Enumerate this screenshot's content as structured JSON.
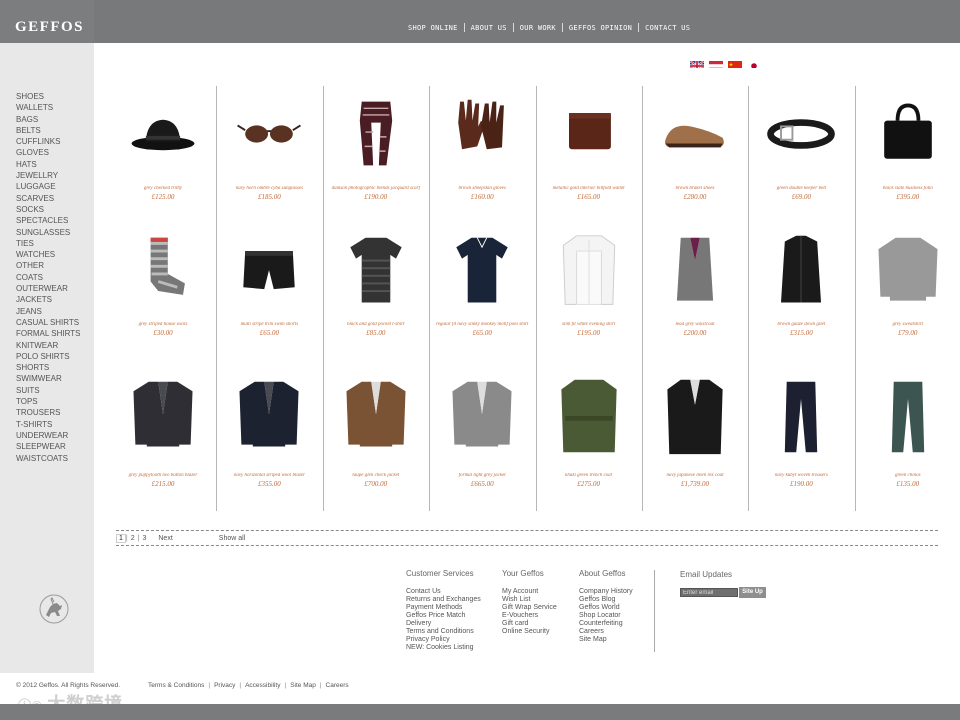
{
  "brand": {
    "logo": "GEFFOS"
  },
  "nav": {
    "items": [
      "SHOP ONLINE",
      "ABOUT US",
      "OUR WORK",
      "GEFFOS OPINION",
      "CONTACT US"
    ]
  },
  "categories": [
    "SHOES",
    "WALLETS",
    "BAGS",
    "BELTS",
    "CUFFLINKS",
    "GLOVES",
    "HATS",
    "JEWELLRY",
    "LUGGAGE",
    "SCARVES",
    "SOCKS",
    "SPECTACLES",
    "SUNGLASSES",
    "TIES",
    "WATCHES",
    "OTHER",
    "COATS",
    "OUTERWEAR",
    "JACKETS",
    "JEANS",
    "CASUAL SHIRTS",
    "FORMAL SHIRTS",
    "KNITWEAR",
    "POLO SHIRTS",
    "SHORTS",
    "SWIMWEAR",
    "SUITS",
    "TOPS",
    "TROUSERS",
    "T-SHIRTS",
    "UNDERWEAR",
    "SLEEPWEAR",
    "WAISTCOATS"
  ],
  "flags": [
    "uk-flag-icon",
    "hungary-flag-icon",
    "china-flag-icon",
    "japan-flag-icon"
  ],
  "products": [
    {
      "name": "grey checked trilby",
      "price": "£125.00",
      "icon": "hat-icon"
    },
    {
      "name": "navy horn ombre cyba sunglasses",
      "price": "£185.00",
      "icon": "sunglasses-icon"
    },
    {
      "name": "damson photographic blends jacquard scarf",
      "price": "£190.00",
      "icon": "scarf-icon"
    },
    {
      "name": "brown sheepskin gloves",
      "price": "£160.00",
      "icon": "gloves-icon"
    },
    {
      "name": "metallic gold interior billfold wallet",
      "price": "£165.00",
      "icon": "wallet-icon"
    },
    {
      "name": "brown brakel shoes",
      "price": "£280.00",
      "icon": "shoe-icon"
    },
    {
      "name": "green double keeper belt",
      "price": "£69.00",
      "icon": "belt-icon"
    },
    {
      "name": "black slate business folio",
      "price": "£395.00",
      "icon": "bag-icon"
    },
    {
      "name": "grey striped house socks",
      "price": "£30.00",
      "icon": "socks-icon"
    },
    {
      "name": "multi stripe trim swim shorts",
      "price": "£65.00",
      "icon": "shorts-icon"
    },
    {
      "name": "black and gold pocket t-shirt",
      "price": "£85.00",
      "icon": "tshirt-icon"
    },
    {
      "name": "regular fit navy slinky monkey motif polo shirt",
      "price": "£65.00",
      "icon": "polo-icon"
    },
    {
      "name": "slim fit white evening shirt",
      "price": "£195.00",
      "icon": "shirt-icon"
    },
    {
      "name": "lead grey waistcoat",
      "price": "£200.00",
      "icon": "waistcoat-icon"
    },
    {
      "name": "brown gauze down gilet",
      "price": "£315.00",
      "icon": "gilet-icon"
    },
    {
      "name": "grey sweatshirt",
      "price": "£79.00",
      "icon": "sweater-icon"
    },
    {
      "name": "grey puppytooth two button blazer",
      "price": "£215.00",
      "icon": "blazer-icon"
    },
    {
      "name": "navy horizontal striped wool blazer",
      "price": "£355.00",
      "icon": "blazer-icon"
    },
    {
      "name": "taupe glen check jacket",
      "price": "£700.00",
      "icon": "jacket-icon"
    },
    {
      "name": "formal light grey jacket",
      "price": "£665.00",
      "icon": "jacket-icon"
    },
    {
      "name": "khaki green trench coat",
      "price": "£275.00",
      "icon": "trench-coat-icon"
    },
    {
      "name": "navy japanese linen rex coat",
      "price": "£1,739.00",
      "icon": "coat-icon"
    },
    {
      "name": "navy kubyt woven trousers",
      "price": "£190.00",
      "icon": "trousers-icon"
    },
    {
      "name": "green chinos",
      "price": "£135.00",
      "icon": "trousers-icon"
    }
  ],
  "pager": {
    "pages": [
      "1",
      "2",
      "3"
    ],
    "next": "Next",
    "show_all": "Show all"
  },
  "footer": {
    "columns": [
      {
        "head": "Customer Services",
        "links": [
          "Contact Us",
          "Returns and Exchanges",
          "Payment Methods",
          "Geffos Price Match",
          "Delivery",
          "Terms and Conditions",
          "Privacy Policy",
          "NEW: Cookies Listing"
        ]
      },
      {
        "head": "Your Geffos",
        "links": [
          "My Account",
          "Wish List",
          "Gift Wrap Service",
          "E-Vouchers",
          "Gift card",
          "Online Security"
        ]
      },
      {
        "head": "About Geffos",
        "links": [
          "Company History",
          "Geffos Blog",
          "Geffos World",
          "Shop Locator",
          "Counterfeiting",
          "Careers",
          "Site Map"
        ]
      }
    ],
    "email": {
      "head": "Email Updates",
      "placeholder": "Enter email",
      "button": "Site Up"
    }
  },
  "bottom": {
    "copyright": "© 2012 Geffos. All Rights Reserved.",
    "links": [
      "Terms & Conditions",
      "Privacy",
      "Accessibility",
      "Site Map",
      "Careers"
    ],
    "watermark": "大数跨境"
  }
}
